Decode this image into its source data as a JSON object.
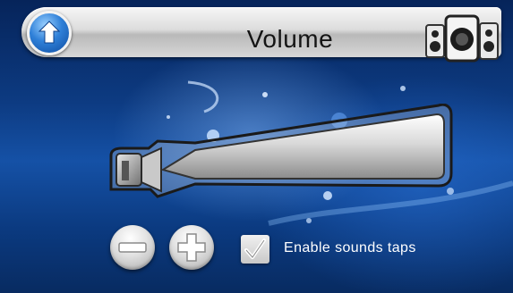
{
  "header": {
    "title": "Volume",
    "back_icon": "back-arrow-icon",
    "speakers_icon": "speakers-icon"
  },
  "volume": {
    "level": 1.0,
    "decrease_icon": "minus-icon",
    "increase_icon": "plus-icon"
  },
  "options": {
    "sound_taps_label": "Enable sounds taps",
    "sound_taps_checked": true
  },
  "colors": {
    "background": "#0d3b82",
    "accent": "#2f80d8",
    "chrome": "#dcdcdc",
    "label_text": "#ffffff"
  }
}
